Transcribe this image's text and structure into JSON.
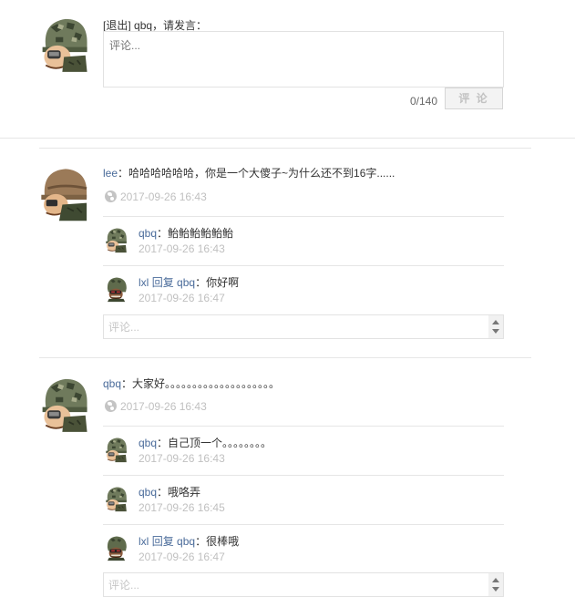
{
  "composer": {
    "logout_label": "[退出]",
    "user_name": "qbq",
    "prompt_suffix": "，请发言：",
    "placeholder": "评论...",
    "counter": "0/140",
    "submit_label": "评 论"
  },
  "comments": [
    {
      "author": "lee",
      "sep": "：",
      "text": "哈哈哈哈哈哈，你是一个大傻子~为什么还不到16字......",
      "time": "2017-09-26 16:43",
      "replies": [
        {
          "author": "qbq",
          "sep": "：",
          "text": "鲐鲐鲐鲐鲐鲐",
          "time": "2017-09-26 16:43"
        },
        {
          "author": "lxl",
          "reply_word": "回复",
          "target": "qbq",
          "sep": "：",
          "text": "你好啊",
          "time": "2017-09-26 16:47"
        }
      ],
      "reply_placeholder": "评论..."
    },
    {
      "author": "qbq",
      "sep": "：",
      "text": "大家好。。。。。。。。。。。。。。。。。。。。",
      "time": "2017-09-26 16:43",
      "replies": [
        {
          "author": "qbq",
          "sep": "：",
          "text": "自己顶一个。。。。。。。。",
          "time": "2017-09-26 16:43"
        },
        {
          "author": "qbq",
          "sep": "：",
          "text": "哦咯弄",
          "time": "2017-09-26 16:45"
        },
        {
          "author": "lxl",
          "reply_word": "回复",
          "target": "qbq",
          "sep": "：",
          "text": "很棒哦",
          "time": "2017-09-26 16:47"
        }
      ],
      "reply_placeholder": "评论..."
    }
  ],
  "colors": {
    "link": "#4a6b9a",
    "timestamp": "#c0c0c0",
    "divider": "#e6e6e6"
  },
  "icons": [
    "soldier-camo-helmet-avatar",
    "soldier-brown-helmet-avatar",
    "soldier-dark-helmet-avatar",
    "globe-icon"
  ]
}
